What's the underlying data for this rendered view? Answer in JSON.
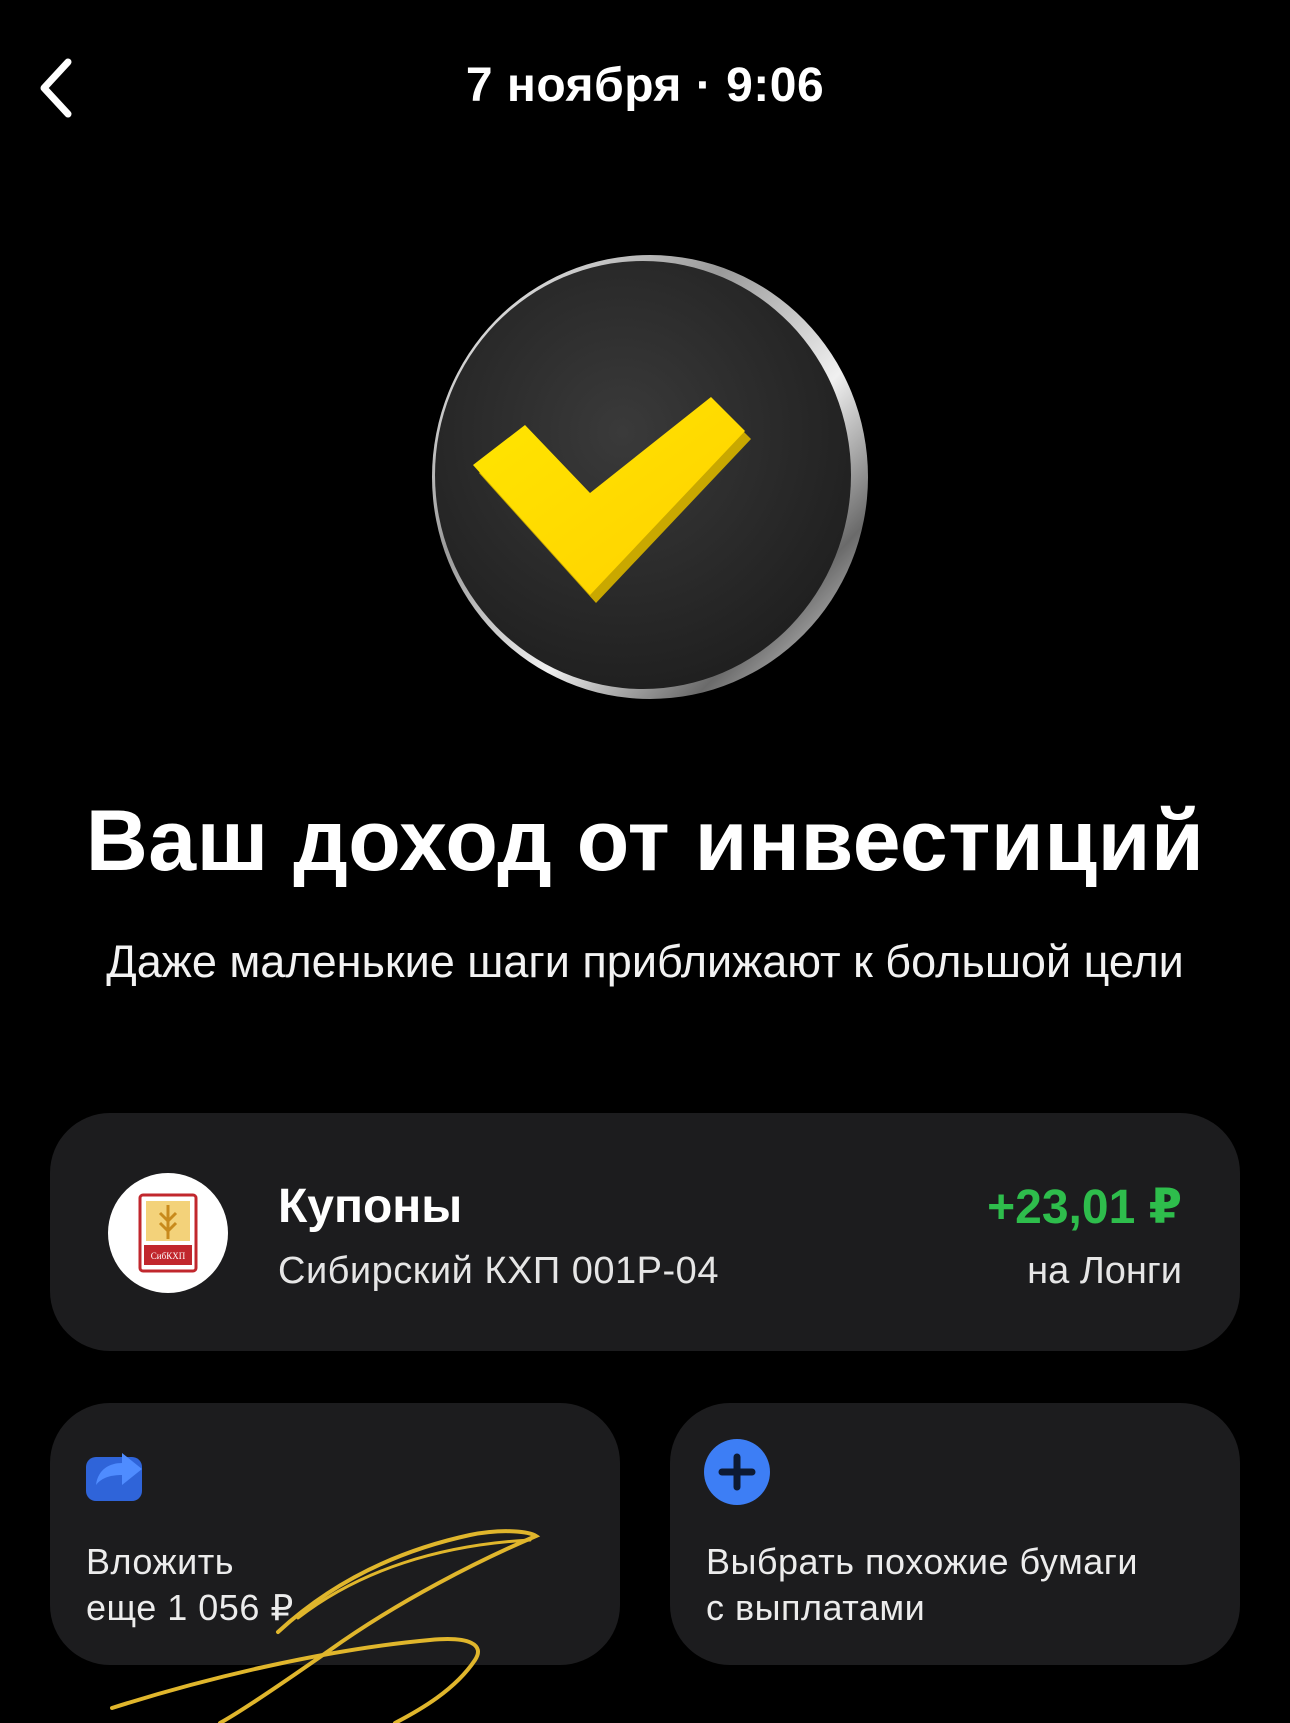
{
  "header": {
    "title": "7 ноября · 9:06"
  },
  "headline": "Ваш доход от инвестиций",
  "subtitle": "Даже маленькие шаги приближают к большой цели",
  "coupon": {
    "title": "Купоны",
    "bond_name": "Сибирский КХП 001Р-04",
    "amount": "+23,01 ₽",
    "destination": "на Лонги",
    "amount_color": "#2ebd4c",
    "logo_text": "СибКХП"
  },
  "actions": {
    "invest": {
      "line1": "Вложить",
      "line2": "еще 1 056 ₽",
      "icon": "share-arrow-icon"
    },
    "similar": {
      "line1": "Выбрать похожие бумаги",
      "line2": "с выплатами",
      "icon": "plus-circle-icon"
    }
  },
  "colors": {
    "accent_yellow": "#ffdd2d",
    "card_bg": "#1c1c1e",
    "positive_green": "#2ebd4c",
    "icon_blue": "#3d7ef5"
  }
}
